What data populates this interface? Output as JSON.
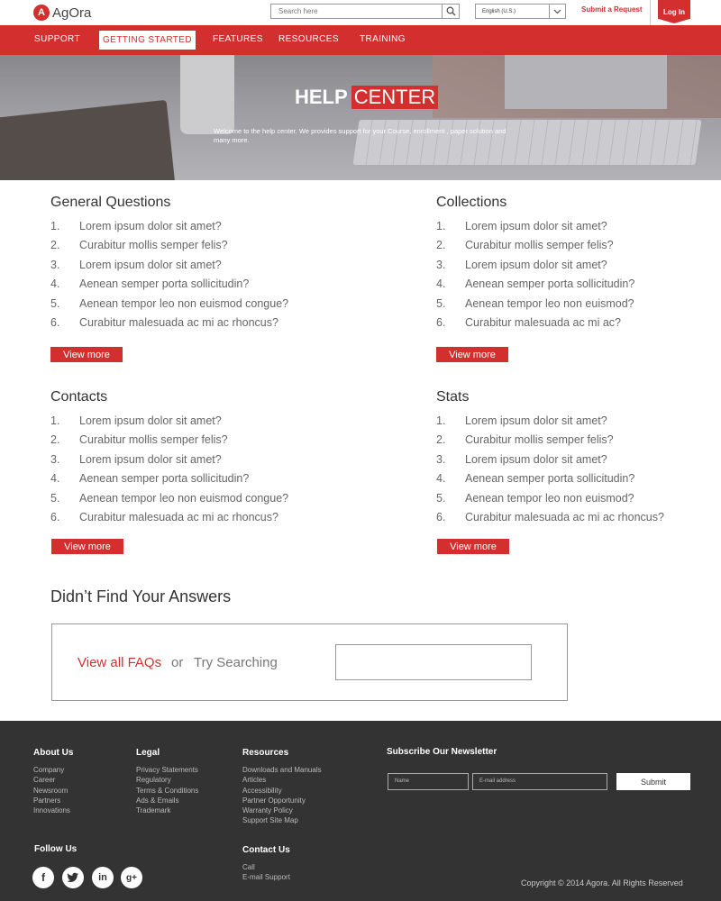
{
  "header": {
    "logo_text": "AgOra",
    "search_placeholder": "Search here",
    "language": "English (U.S.)",
    "submit_request": "Submit a Request",
    "login": "Log In"
  },
  "nav": [
    "SUPPORT",
    "GETTING STARTED",
    "FEATURES",
    "RESOURCES",
    "TRAINING"
  ],
  "nav_active": "GETTING STARTED",
  "hero": {
    "title_bold": "HELP",
    "title_highlight": "CENTER",
    "subtitle": "Welcome to the help center. We provides support for your Course, enrollment , paper solution and many more."
  },
  "sections": [
    {
      "title": "General Questions",
      "items": [
        "Lorem ipsum dolor sit amet?",
        "Curabitur mollis semper felis?",
        "Lorem ipsum dolor sit amet?",
        "Aenean semper porta sollicitudin?",
        "Aenean tempor leo non euismod congue?",
        "Curabitur malesuada ac mi ac rhoncus?"
      ],
      "button": "View more"
    },
    {
      "title": "Collections",
      "items": [
        "Lorem ipsum dolor sit amet?",
        "Curabitur mollis semper felis?",
        "Lorem ipsum dolor sit amet?",
        "Aenean semper porta sollicitudin?",
        "Aenean tempor leo non euismod?",
        "Curabitur malesuada ac mi ac?"
      ],
      "button": "View more"
    },
    {
      "title": "Contacts",
      "items": [
        "Lorem ipsum dolor sit amet?",
        "Curabitur mollis semper felis?",
        "Lorem ipsum dolor sit amet?",
        "Aenean semper porta sollicitudin?",
        "Aenean tempor leo non euismod congue?",
        "Curabitur malesuada ac mi ac rhoncus?"
      ],
      "button": "View more"
    },
    {
      "title": "Stats",
      "items": [
        "Lorem ipsum dolor sit amet?",
        "Curabitur mollis semper felis?",
        "Lorem ipsum dolor sit amet?",
        "Aenean semper porta sollicitudin?",
        "Aenean tempor leo non euismod?",
        "Curabitur malesuada ac mi ac rhoncus?"
      ],
      "button": "View more"
    }
  ],
  "faq": {
    "heading": "Didn’t Find Your Answers",
    "view_all": "View all FAQs",
    "or": "or",
    "try_searching": "Try Searching"
  },
  "footer": {
    "about": {
      "title": "About Us",
      "links": [
        "Company",
        "Career",
        "Newsroom",
        "Partners",
        "Innovations"
      ]
    },
    "legal": {
      "title": "Legal",
      "links": [
        "Privacy Statements",
        "Regulatory",
        "Terms & Conditions",
        "Ads & Emails",
        "Trademark"
      ]
    },
    "resources": {
      "title": "Resources",
      "links": [
        "Downloads and Manuals",
        "Articles",
        "Accessibility",
        "Partner Opportunity",
        "Warranty Policy",
        "Support Site Map"
      ]
    },
    "newsletter": {
      "title": "Subscribe Our Newsletter",
      "name_placeholder": "Name",
      "email_placeholder": "E-mail address",
      "submit": "Submit"
    },
    "follow": {
      "title": "Follow Us",
      "icons": [
        "facebook-icon",
        "twitter-icon",
        "linkedin-icon",
        "googleplus-icon"
      ]
    },
    "contact": {
      "title": "Contact Us",
      "links": [
        "Call",
        "E-mail Support"
      ]
    },
    "copyright": "Copyright © 2014 Agora. All Rights Reserved"
  },
  "colors": {
    "accent": "#d32f2f",
    "footer_bg": "#333333"
  }
}
